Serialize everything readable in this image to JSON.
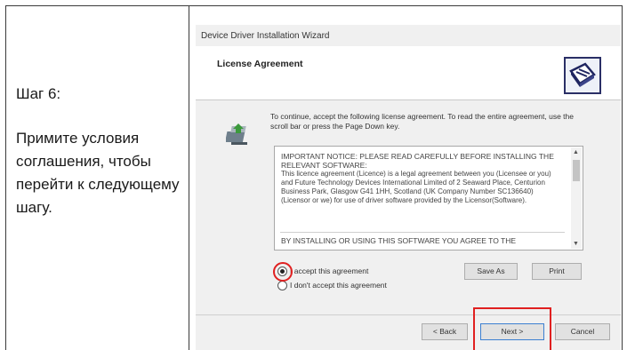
{
  "left_panel": {
    "step_title": "Шаг 6:",
    "step_body": "Примите условия соглашения, чтобы перейти к следующему шагу."
  },
  "wizard": {
    "window_title": "Device Driver Installation Wizard",
    "header_title": "License Agreement",
    "intro_text": "To continue, accept the following license agreement. To read the entire agreement, use the scroll bar or press the Page Down key.",
    "license": {
      "notice_head": "IMPORTANT NOTICE: PLEASE READ CAREFULLY BEFORE INSTALLING THE RELEVANT SOFTWARE:",
      "notice_body": "This licence agreement (Licence) is a legal agreement between you (Licensee or you) and Future Technology Devices International Limited of 2 Seaward Place, Centurion Business Park, Glasgow G41 1HH, Scotland (UK Company Number SC136640) (Licensor or we) for use of driver software provided by the Licensor(Software).",
      "last_line": "BY INSTALLING OR USING THIS SOFTWARE YOU AGREE TO THE"
    },
    "radio_accept": {
      "label": "I accept this agreement",
      "selected": true
    },
    "radio_decline": {
      "label": "I don't accept this agreement",
      "selected": false
    },
    "buttons": {
      "save_as": "Save As",
      "print": "Print",
      "back": "< Back",
      "next": "Next >",
      "cancel": "Cancel"
    },
    "icons": {
      "header_icon": "wizard-logo-icon",
      "setup_icon": "setup-package-icon",
      "scroll_up": "chevron-up-icon",
      "scroll_down": "chevron-down-icon"
    }
  },
  "colors": {
    "highlight": "#e02020",
    "dialog_bg": "#f0f0f0",
    "frame_border": "#3a3a3a"
  }
}
